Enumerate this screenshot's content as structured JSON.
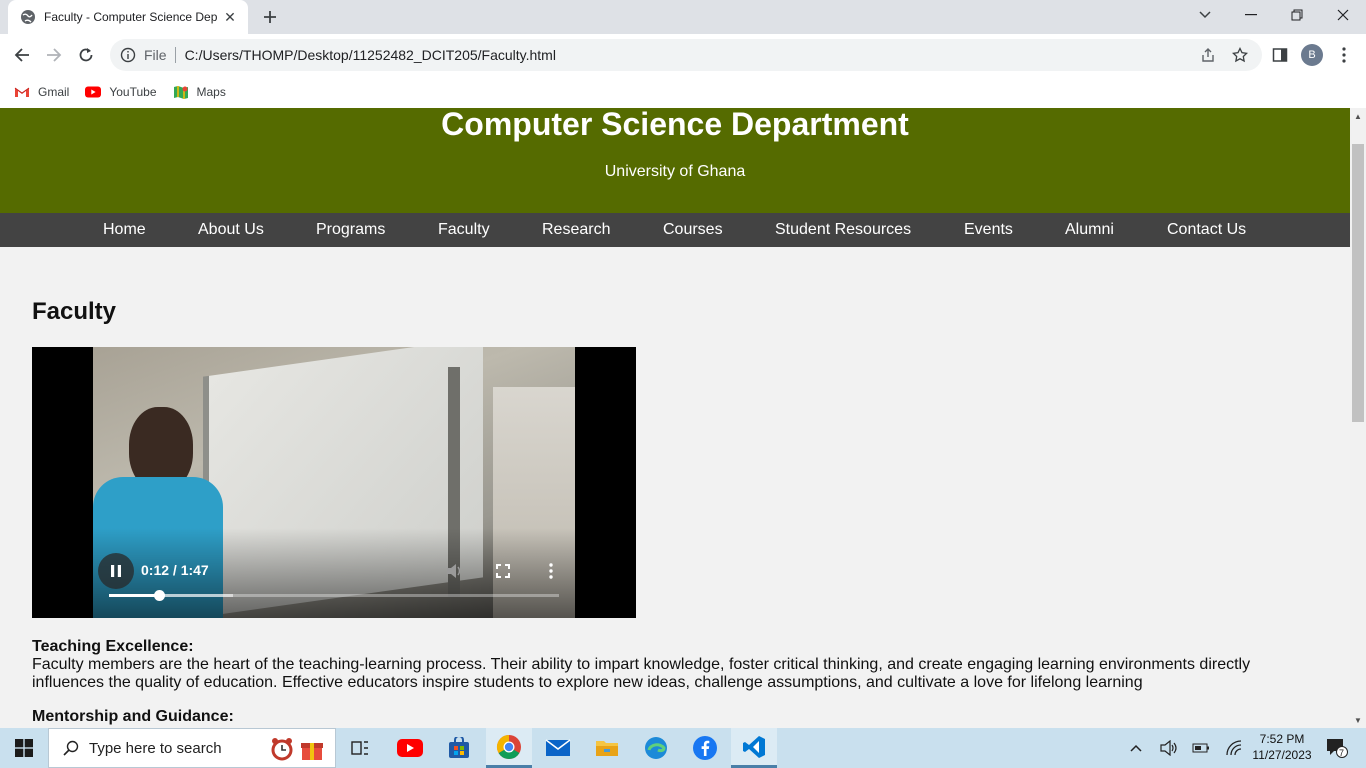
{
  "browser": {
    "tab_title": "Faculty - Computer Science Dep",
    "scheme_label": "File",
    "url": "C:/Users/THOMP/Desktop/11252482_DCIT205/Faculty.html",
    "profile_initial": "B",
    "bookmarks": [
      {
        "label": "Gmail",
        "icon": "gmail-icon"
      },
      {
        "label": "YouTube",
        "icon": "youtube-icon"
      },
      {
        "label": "Maps",
        "icon": "maps-icon"
      }
    ]
  },
  "site": {
    "title": "Computer Science Department",
    "subtitle": "University of Ghana",
    "header_color": "#556b00",
    "nav_color": "#434343",
    "nav": [
      "Home",
      "About Us",
      "Programs",
      "Faculty",
      "Research",
      "Courses",
      "Student Resources",
      "Events",
      "Alumni",
      "Contact Us"
    ]
  },
  "main": {
    "heading": "Faculty",
    "video": {
      "time_display": "0:12 / 1:47",
      "played_fraction": 0.112,
      "buffered_fraction": 0.275
    },
    "sections": [
      {
        "title": "Teaching Excellence:",
        "body": "Faculty members are the heart of the teaching-learning process. Their ability to impart knowledge, foster critical thinking, and create engaging learning environments directly influences the quality of education. Effective educators inspire students to explore new ideas, challenge assumptions, and cultivate a love for lifelong learning"
      },
      {
        "title": "Mentorship and Guidance:",
        "body": ""
      }
    ]
  },
  "taskbar": {
    "search_placeholder": "Type here to search",
    "time": "7:52 PM",
    "date": "11/27/2023",
    "notification_count": "7"
  }
}
